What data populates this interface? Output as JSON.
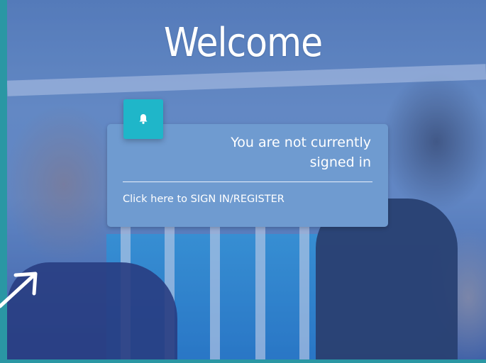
{
  "header": {
    "title": "Welcome"
  },
  "notice": {
    "icon": "bell-icon",
    "message": "You are not currently signed in",
    "link_label": "Click here to SIGN IN/REGISTER"
  },
  "colors": {
    "frame": "#2a97a4",
    "card": "#6f9bd0",
    "icon_box": "#1fb6c9",
    "text": "#ffffff"
  },
  "decorations": {
    "arrow_icon": "arrow-up-right-icon"
  }
}
